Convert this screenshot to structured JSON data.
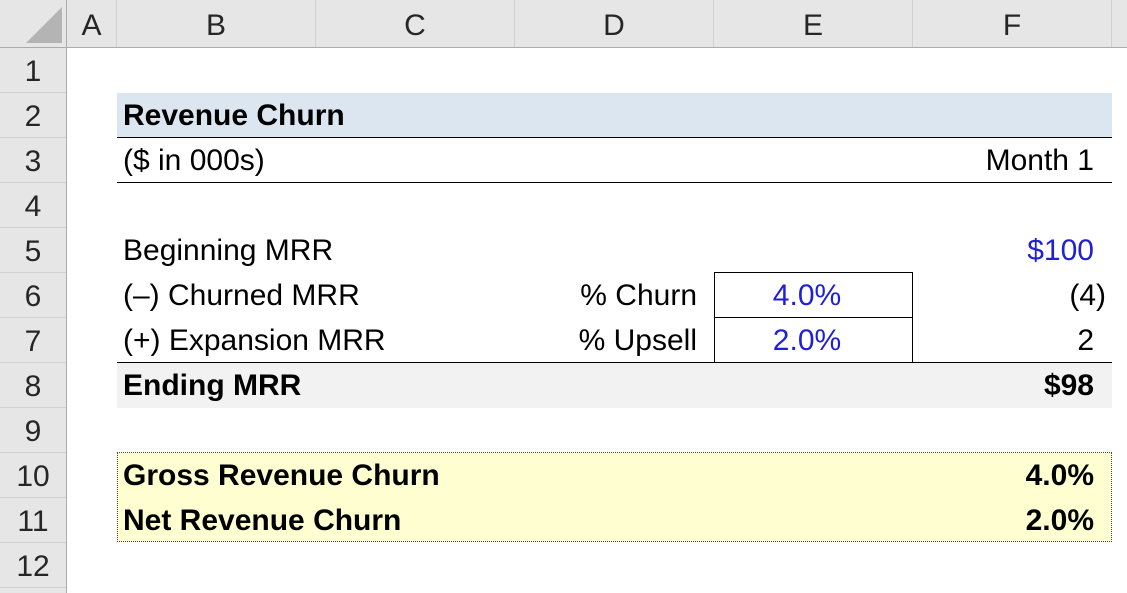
{
  "columns": [
    "A",
    "B",
    "C",
    "D",
    "E",
    "F"
  ],
  "rows": [
    "1",
    "2",
    "3",
    "4",
    "5",
    "6",
    "7",
    "8",
    "9",
    "10",
    "11",
    "12"
  ],
  "table": {
    "title": "Revenue Churn",
    "units": "($ in 000s)",
    "period": "Month 1",
    "beginning_mrr": {
      "label": "Beginning MRR",
      "value": "$100"
    },
    "churned_mrr": {
      "label": "(–) Churned MRR",
      "rate_label": "% Churn",
      "rate": "4.0%",
      "value": "(4)"
    },
    "expansion_mrr": {
      "label": "(+) Expansion MRR",
      "rate_label": "% Upsell",
      "rate": "2.0%",
      "value": "2"
    },
    "ending_mrr": {
      "label": "Ending MRR",
      "value": "$98"
    },
    "gross_churn": {
      "label": "Gross Revenue Churn",
      "value": "4.0%"
    },
    "net_churn": {
      "label": "Net Revenue Churn",
      "value": "2.0%"
    }
  },
  "colors": {
    "title_band": "#dce6f1",
    "ending_band": "#f2f2f2",
    "summary_band": "#fefed0",
    "input_blue": "#1f1fd6",
    "header_gray": "#e6e6e6"
  }
}
